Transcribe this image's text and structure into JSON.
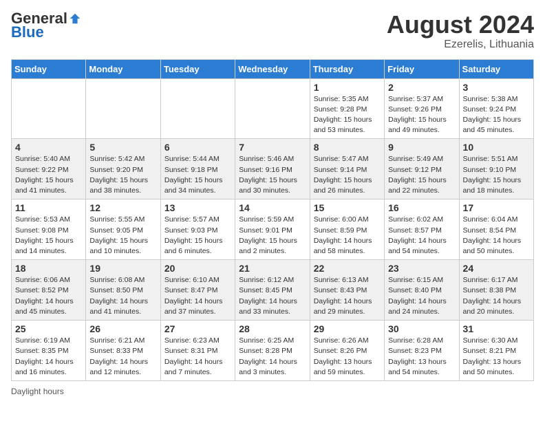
{
  "header": {
    "logo_general": "General",
    "logo_blue": "Blue",
    "month_year": "August 2024",
    "location": "Ezerelis, Lithuania"
  },
  "days_of_week": [
    "Sunday",
    "Monday",
    "Tuesday",
    "Wednesday",
    "Thursday",
    "Friday",
    "Saturday"
  ],
  "weeks": [
    [
      {
        "day": "",
        "info": ""
      },
      {
        "day": "",
        "info": ""
      },
      {
        "day": "",
        "info": ""
      },
      {
        "day": "",
        "info": ""
      },
      {
        "day": "1",
        "info": "Sunrise: 5:35 AM\nSunset: 9:28 PM\nDaylight: 15 hours\nand 53 minutes."
      },
      {
        "day": "2",
        "info": "Sunrise: 5:37 AM\nSunset: 9:26 PM\nDaylight: 15 hours\nand 49 minutes."
      },
      {
        "day": "3",
        "info": "Sunrise: 5:38 AM\nSunset: 9:24 PM\nDaylight: 15 hours\nand 45 minutes."
      }
    ],
    [
      {
        "day": "4",
        "info": "Sunrise: 5:40 AM\nSunset: 9:22 PM\nDaylight: 15 hours\nand 41 minutes."
      },
      {
        "day": "5",
        "info": "Sunrise: 5:42 AM\nSunset: 9:20 PM\nDaylight: 15 hours\nand 38 minutes."
      },
      {
        "day": "6",
        "info": "Sunrise: 5:44 AM\nSunset: 9:18 PM\nDaylight: 15 hours\nand 34 minutes."
      },
      {
        "day": "7",
        "info": "Sunrise: 5:46 AM\nSunset: 9:16 PM\nDaylight: 15 hours\nand 30 minutes."
      },
      {
        "day": "8",
        "info": "Sunrise: 5:47 AM\nSunset: 9:14 PM\nDaylight: 15 hours\nand 26 minutes."
      },
      {
        "day": "9",
        "info": "Sunrise: 5:49 AM\nSunset: 9:12 PM\nDaylight: 15 hours\nand 22 minutes."
      },
      {
        "day": "10",
        "info": "Sunrise: 5:51 AM\nSunset: 9:10 PM\nDaylight: 15 hours\nand 18 minutes."
      }
    ],
    [
      {
        "day": "11",
        "info": "Sunrise: 5:53 AM\nSunset: 9:08 PM\nDaylight: 15 hours\nand 14 minutes."
      },
      {
        "day": "12",
        "info": "Sunrise: 5:55 AM\nSunset: 9:05 PM\nDaylight: 15 hours\nand 10 minutes."
      },
      {
        "day": "13",
        "info": "Sunrise: 5:57 AM\nSunset: 9:03 PM\nDaylight: 15 hours\nand 6 minutes."
      },
      {
        "day": "14",
        "info": "Sunrise: 5:59 AM\nSunset: 9:01 PM\nDaylight: 15 hours\nand 2 minutes."
      },
      {
        "day": "15",
        "info": "Sunrise: 6:00 AM\nSunset: 8:59 PM\nDaylight: 14 hours\nand 58 minutes."
      },
      {
        "day": "16",
        "info": "Sunrise: 6:02 AM\nSunset: 8:57 PM\nDaylight: 14 hours\nand 54 minutes."
      },
      {
        "day": "17",
        "info": "Sunrise: 6:04 AM\nSunset: 8:54 PM\nDaylight: 14 hours\nand 50 minutes."
      }
    ],
    [
      {
        "day": "18",
        "info": "Sunrise: 6:06 AM\nSunset: 8:52 PM\nDaylight: 14 hours\nand 45 minutes."
      },
      {
        "day": "19",
        "info": "Sunrise: 6:08 AM\nSunset: 8:50 PM\nDaylight: 14 hours\nand 41 minutes."
      },
      {
        "day": "20",
        "info": "Sunrise: 6:10 AM\nSunset: 8:47 PM\nDaylight: 14 hours\nand 37 minutes."
      },
      {
        "day": "21",
        "info": "Sunrise: 6:12 AM\nSunset: 8:45 PM\nDaylight: 14 hours\nand 33 minutes."
      },
      {
        "day": "22",
        "info": "Sunrise: 6:13 AM\nSunset: 8:43 PM\nDaylight: 14 hours\nand 29 minutes."
      },
      {
        "day": "23",
        "info": "Sunrise: 6:15 AM\nSunset: 8:40 PM\nDaylight: 14 hours\nand 24 minutes."
      },
      {
        "day": "24",
        "info": "Sunrise: 6:17 AM\nSunset: 8:38 PM\nDaylight: 14 hours\nand 20 minutes."
      }
    ],
    [
      {
        "day": "25",
        "info": "Sunrise: 6:19 AM\nSunset: 8:35 PM\nDaylight: 14 hours\nand 16 minutes."
      },
      {
        "day": "26",
        "info": "Sunrise: 6:21 AM\nSunset: 8:33 PM\nDaylight: 14 hours\nand 12 minutes."
      },
      {
        "day": "27",
        "info": "Sunrise: 6:23 AM\nSunset: 8:31 PM\nDaylight: 14 hours\nand 7 minutes."
      },
      {
        "day": "28",
        "info": "Sunrise: 6:25 AM\nSunset: 8:28 PM\nDaylight: 14 hours\nand 3 minutes."
      },
      {
        "day": "29",
        "info": "Sunrise: 6:26 AM\nSunset: 8:26 PM\nDaylight: 13 hours\nand 59 minutes."
      },
      {
        "day": "30",
        "info": "Sunrise: 6:28 AM\nSunset: 8:23 PM\nDaylight: 13 hours\nand 54 minutes."
      },
      {
        "day": "31",
        "info": "Sunrise: 6:30 AM\nSunset: 8:21 PM\nDaylight: 13 hours\nand 50 minutes."
      }
    ]
  ],
  "footer": {
    "note": "Daylight hours"
  }
}
